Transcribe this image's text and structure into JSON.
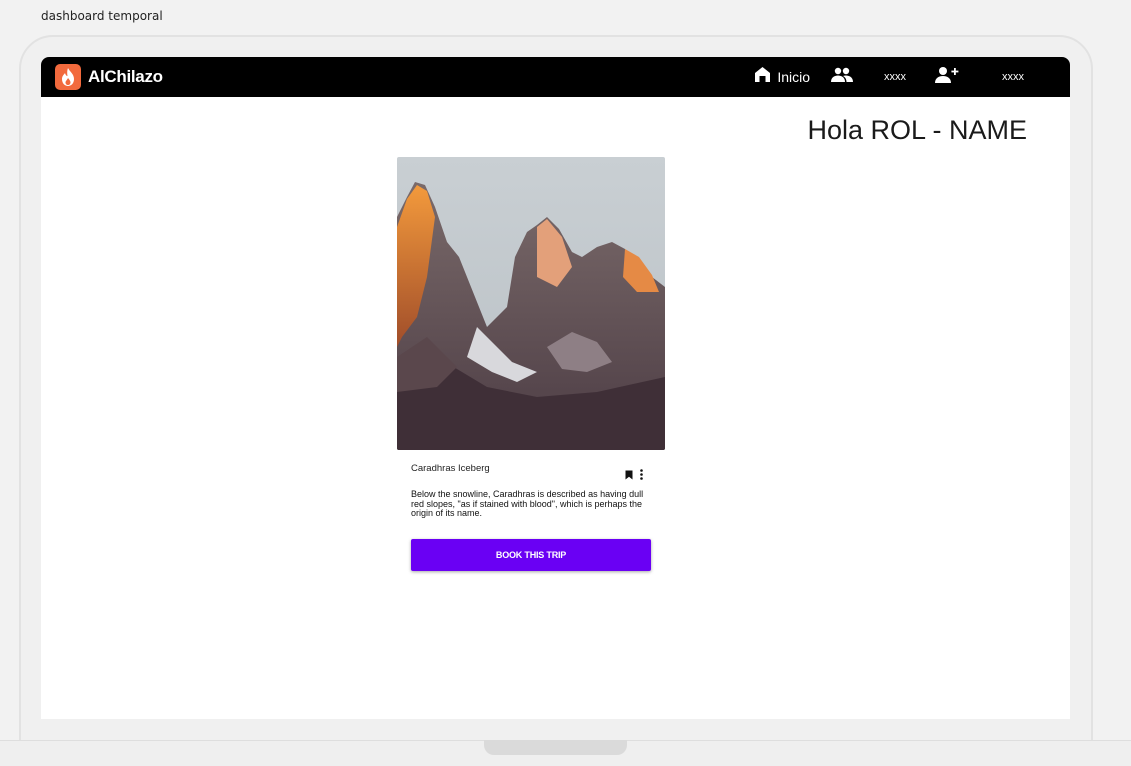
{
  "page": {
    "caption": "dashboard temporal"
  },
  "navbar": {
    "brand": "AlChilazo",
    "items": [
      {
        "label": "Inicio",
        "icon": "home-icon"
      },
      {
        "label": "xxxx",
        "icon": "group-icon"
      },
      {
        "label": "xxxx",
        "icon": "person-add-icon"
      }
    ]
  },
  "greeting": "Hola ROL - NAME",
  "card": {
    "title": "Caradhras Iceberg",
    "description": "Below the snowline, Caradhras is described as having dull red slopes, \"as if stained with blood\", which is perhaps the origin of its name.",
    "button_label": "BOOK THIS TRIP",
    "actions": [
      "bookmark-icon",
      "more-vert-icon"
    ]
  },
  "colors": {
    "navbar_bg": "#000000",
    "brand_accent": "#f26a3d",
    "button_bg": "#6a00f4",
    "screen_bg": "#ffffff",
    "frame_bg": "#f0f0f0"
  }
}
